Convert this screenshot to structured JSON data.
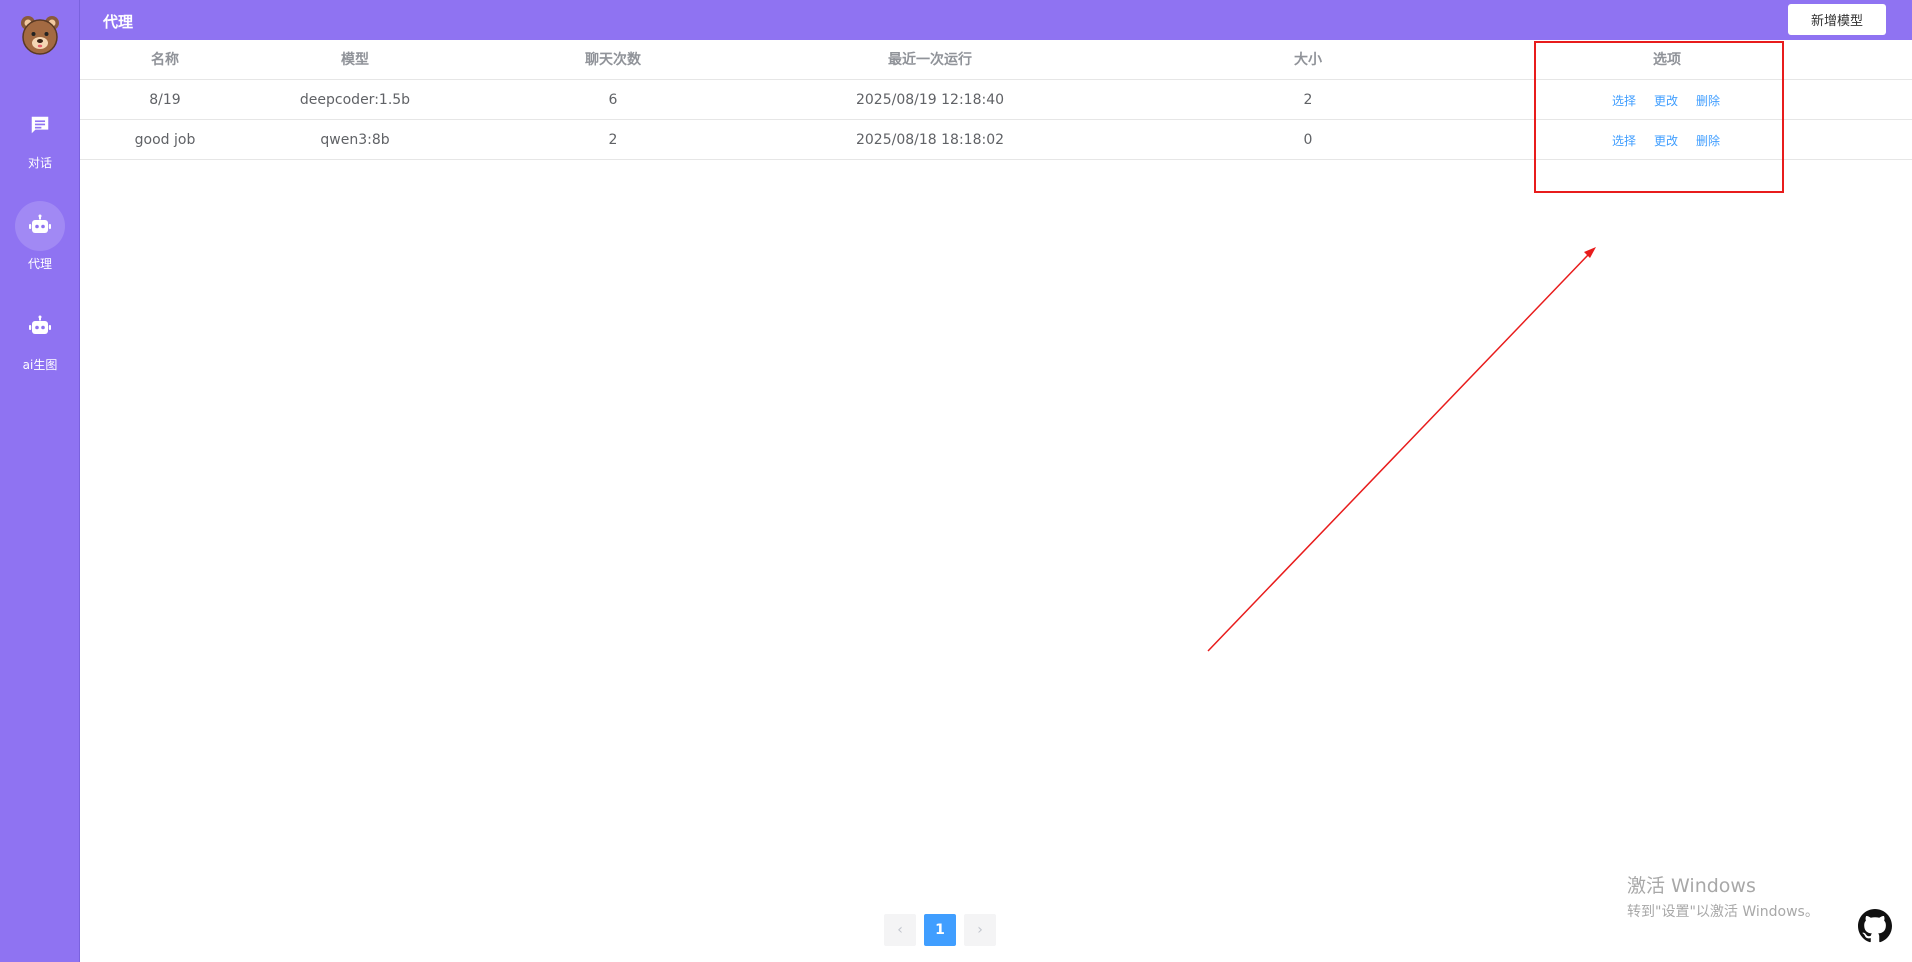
{
  "app": {
    "accent_color": "#8f73f2",
    "link_color": "#409eff",
    "highlight_color": "#e81c1c"
  },
  "sidebar": {
    "logo_icon": "bear-logo-icon",
    "items": [
      {
        "label": "对话",
        "icon": "chat-icon",
        "active": false
      },
      {
        "label": "代理",
        "icon": "robot-icon",
        "active": true
      },
      {
        "label": "ai生图",
        "icon": "robot-icon",
        "active": false
      }
    ]
  },
  "header": {
    "title": "代理",
    "add_button_label": "新增模型"
  },
  "table": {
    "columns": [
      "名称",
      "模型",
      "聊天次数",
      "最近一次运行",
      "大小",
      "选项"
    ],
    "rows": [
      {
        "name": "8/19",
        "model": "deepcoder:1.5b",
        "chat_count": "6",
        "last_run": "2025/08/19 12:18:40",
        "size": "2",
        "actions": [
          "选择",
          "更改",
          "删除"
        ]
      },
      {
        "name": "good job",
        "model": "qwen3:8b",
        "chat_count": "2",
        "last_run": "2025/08/18 18:18:02",
        "size": "0",
        "actions": [
          "选择",
          "更改",
          "删除"
        ]
      }
    ]
  },
  "pagination": {
    "prev_icon": "chevron-left-icon",
    "current_page": "1",
    "next_icon": "chevron-right-icon"
  },
  "watermark": {
    "title": "激活 Windows",
    "subtitle": "转到\"设置\"以激活 Windows。"
  },
  "footer": {
    "github_icon": "github-icon"
  }
}
